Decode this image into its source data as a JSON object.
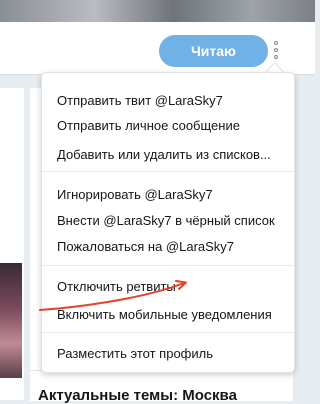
{
  "header": {
    "reading_button": "Читаю"
  },
  "menu": {
    "items": [
      {
        "label": "Отправить твит @LaraSky7"
      },
      {
        "label": "Отправить личное сообщение"
      },
      {
        "label": "Добавить или удалить из списков..."
      },
      {
        "label": "Игнорировать @LaraSky7"
      },
      {
        "label": "Внести @LaraSky7 в чёрный список"
      },
      {
        "label": "Пожаловаться на @LaraSky7"
      },
      {
        "label": "Отключить ретвиты"
      },
      {
        "label": "Включить мобильные уведомления"
      },
      {
        "label": "Разместить этот профиль"
      }
    ]
  },
  "trends": {
    "title": "Актуальные темы: Москва"
  },
  "colors": {
    "accent": "#70b1e6",
    "annotation_arrow": "#e0442a"
  }
}
